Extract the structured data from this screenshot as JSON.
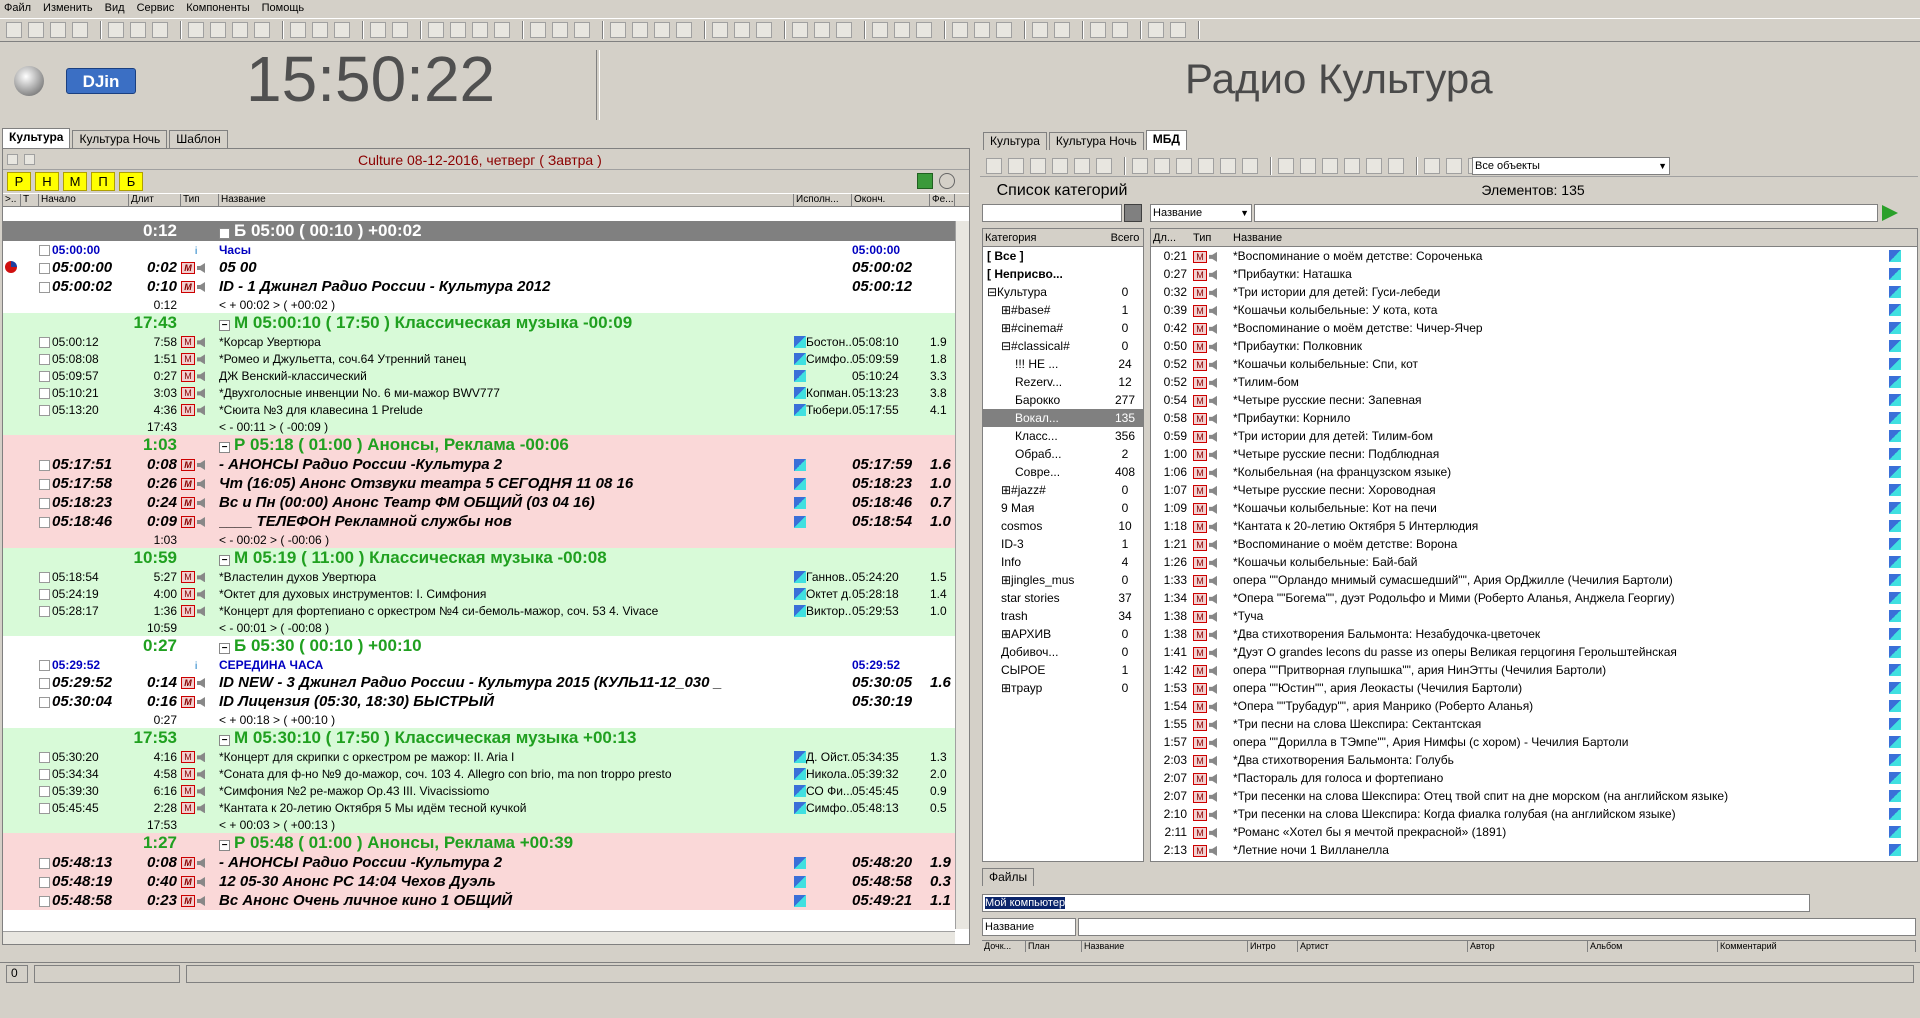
{
  "menu": [
    "Файл",
    "Изменить",
    "Вид",
    "Сервис",
    "Компоненты",
    "Помощь"
  ],
  "logo": "DJin",
  "clock": "15:50:22",
  "station": "Радио Культура",
  "left_tabs": [
    "Культура",
    "Культура Ночь",
    "Шаблон"
  ],
  "playlist_title": "Culture 08-12-2016, четверг ( Завтра )",
  "yellow_buttons": [
    "Р",
    "Н",
    "М",
    "П",
    "Б"
  ],
  "columns": [
    ">..",
    "Т",
    "Начало",
    "Длит",
    "Тип",
    "Название",
    "Исполн...",
    "Оконч.",
    "Фе..."
  ],
  "rows": [
    {
      "k": "blk",
      "bg": "gray",
      "dur": "0:12",
      "name": "Б 05:00 ( 00:10 ) +00:02"
    },
    {
      "k": "it",
      "bg": "white",
      "start": "05:00:00",
      "name": "Часы",
      "end": "05:00:00",
      "blue": true
    },
    {
      "k": "big",
      "bg": "white",
      "start": "05:00:00",
      "dur": "0:02",
      "name": "05 00",
      "end": "05:00:02"
    },
    {
      "k": "big",
      "bg": "white",
      "start": "05:00:02",
      "dur": "0:10",
      "name": "ID - 1 Джингл Радио России - Культура 2012",
      "end": "05:00:12"
    },
    {
      "k": "it",
      "bg": "white",
      "dur": "0:12",
      "name": "< + 00:02 > ( +00:02 )"
    },
    {
      "k": "blk",
      "bg": "green",
      "dur": "17:43",
      "name": "М 05:00:10 ( 17:50 ) Классическая музыка -00:09"
    },
    {
      "k": "it",
      "bg": "green",
      "start": "05:00:12",
      "dur": "7:58",
      "name": "*Корсар Увертюра",
      "art": "Бостон...",
      "end": "05:08:10",
      "fe": "1.9"
    },
    {
      "k": "it",
      "bg": "green",
      "start": "05:08:08",
      "dur": "1:51",
      "name": "*Ромео и Джульетта, соч.64 Утренний танец",
      "art": "Симфо...",
      "end": "05:09:59",
      "fe": "1.8"
    },
    {
      "k": "it",
      "bg": "green",
      "start": "05:09:57",
      "dur": "0:27",
      "name": "ДЖ Венский-классический",
      "art": "",
      "end": "05:10:24",
      "fe": "3.3"
    },
    {
      "k": "it",
      "bg": "green",
      "start": "05:10:21",
      "dur": "3:03",
      "name": "*Двухголосные инвенции No. 6 ми-мажор BWV777",
      "art": "Копман...",
      "end": "05:13:23",
      "fe": "3.8"
    },
    {
      "k": "it",
      "bg": "green",
      "start": "05:13:20",
      "dur": "4:36",
      "name": "*Сюита №3 для клавесина 1 Prelude",
      "art": "Тюбери...",
      "end": "05:17:55",
      "fe": "4.1"
    },
    {
      "k": "it",
      "bg": "green",
      "dur": "17:43",
      "name": "< - 00:11 > ( -00:09 )"
    },
    {
      "k": "blk",
      "bg": "pink",
      "dur": "1:03",
      "name": "Р 05:18 ( 01:00 ) Анонсы, Реклама -00:06"
    },
    {
      "k": "big",
      "bg": "pink",
      "start": "05:17:51",
      "dur": "0:08",
      "name": "- АНОНСЫ Радио России -Культура 2",
      "end": "05:17:59",
      "fe": "1.6"
    },
    {
      "k": "big",
      "bg": "pink",
      "start": "05:17:58",
      "dur": "0:26",
      "name": "Чт (16:05) Анонс Отзвуки театра 5 СЕГОДНЯ 11 08 16",
      "end": "05:18:23",
      "fe": "1.0"
    },
    {
      "k": "big",
      "bg": "pink",
      "start": "05:18:23",
      "dur": "0:24",
      "name": "Вс и Пн (00:00) Анонс Театр ФМ ОБЩИЙ (03 04 16)",
      "end": "05:18:46",
      "fe": "0.7"
    },
    {
      "k": "big",
      "bg": "pink",
      "start": "05:18:46",
      "dur": "0:09",
      "name": "____ ТЕЛЕФОН Рекламной службы нов",
      "end": "05:18:54",
      "fe": "1.0"
    },
    {
      "k": "it",
      "bg": "pink",
      "dur": "1:03",
      "name": "< - 00:02 > ( -00:06 )"
    },
    {
      "k": "blk",
      "bg": "green",
      "dur": "10:59",
      "name": "М 05:19 ( 11:00 ) Классическая  музыка -00:08"
    },
    {
      "k": "it",
      "bg": "green",
      "start": "05:18:54",
      "dur": "5:27",
      "name": "*Властелин духов Увертюра",
      "art": "Ганнов...",
      "end": "05:24:20",
      "fe": "1.5"
    },
    {
      "k": "it",
      "bg": "green",
      "start": "05:24:19",
      "dur": "4:00",
      "name": "*Октет для духовых инструментов: I. Симфония",
      "art": "Октет д...",
      "end": "05:28:18",
      "fe": "1.4"
    },
    {
      "k": "it",
      "bg": "green",
      "start": "05:28:17",
      "dur": "1:36",
      "name": "*Концерт для фортепиано с оркестром №4 си-бемоль-мажор, соч. 53 4. Vivace",
      "art": "Виктор...",
      "end": "05:29:53",
      "fe": "1.0"
    },
    {
      "k": "it",
      "bg": "green",
      "dur": "10:59",
      "name": "< - 00:01 > ( -00:08 )"
    },
    {
      "k": "blk",
      "bg": "white",
      "dur": "0:27",
      "name": "Б 05:30 ( 00:10 ) +00:10"
    },
    {
      "k": "it",
      "bg": "white",
      "start": "05:29:52",
      "name": "СЕРЕДИНА ЧАСА",
      "end": "05:29:52",
      "blue": true
    },
    {
      "k": "big",
      "bg": "white",
      "start": "05:29:52",
      "dur": "0:14",
      "name": "ID NEW - 3 Джингл Радио России - Культура 2015 (КУЛЬ11-12_030 _",
      "end": "05:30:05",
      "fe": "1.6"
    },
    {
      "k": "big",
      "bg": "white",
      "start": "05:30:04",
      "dur": "0:16",
      "name": "ID Лицензия (05:30, 18:30) БЫСТРЫЙ",
      "end": "05:30:19"
    },
    {
      "k": "it",
      "bg": "white",
      "dur": "0:27",
      "name": "< + 00:18 > ( +00:10 )"
    },
    {
      "k": "blk",
      "bg": "green",
      "dur": "17:53",
      "name": "М 05:30:10 ( 17:50 ) Классическая музыка +00:13"
    },
    {
      "k": "it",
      "bg": "green",
      "start": "05:30:20",
      "dur": "4:16",
      "name": "*Концерт для скрипки с оркестром ре мажор: II. Aria I",
      "art": "Д. Ойст...",
      "end": "05:34:35",
      "fe": "1.3"
    },
    {
      "k": "it",
      "bg": "green",
      "start": "05:34:34",
      "dur": "4:58",
      "name": "*Соната для ф-но №9 до-мажор, соч. 103 4. Allegro con brio, ma non troppo presto",
      "art": "Никола...",
      "end": "05:39:32",
      "fe": "2.0"
    },
    {
      "k": "it",
      "bg": "green",
      "start": "05:39:30",
      "dur": "6:16",
      "name": "*Симфония №2 ре-мажор Op.43 III. Vivacissiomo",
      "art": "СО Фи...",
      "end": "05:45:45",
      "fe": "0.9"
    },
    {
      "k": "it",
      "bg": "green",
      "start": "05:45:45",
      "dur": "2:28",
      "name": "*Кантата к 20-летию Октября 5 Мы идём тесной кучкой",
      "art": "Симфо...",
      "end": "05:48:13",
      "fe": "0.5"
    },
    {
      "k": "it",
      "bg": "green",
      "dur": "17:53",
      "name": "< + 00:03 > ( +00:13 )"
    },
    {
      "k": "blk",
      "bg": "pink",
      "dur": "1:27",
      "name": "Р 05:48 ( 01:00 ) Анонсы, Реклама +00:39"
    },
    {
      "k": "big",
      "bg": "pink",
      "start": "05:48:13",
      "dur": "0:08",
      "name": "- АНОНСЫ Радио России -Культура 2",
      "end": "05:48:20",
      "fe": "1.9"
    },
    {
      "k": "big",
      "bg": "pink",
      "start": "05:48:19",
      "dur": "0:40",
      "name": "12 05-30 Анонс РС 14:04 Чехов Дуэль",
      "end": "05:48:58",
      "fe": "0.3"
    },
    {
      "k": "big",
      "bg": "pink",
      "start": "05:48:58",
      "dur": "0:23",
      "name": "Вс Анонс Очень личное кино 1 ОБЩИЙ",
      "end": "05:49:21",
      "fe": "1.1"
    }
  ],
  "right_tabs": [
    "Культура",
    "Культура Ночь",
    "МБД"
  ],
  "filter_select": "Все объекты",
  "cat_title": "Список категорий",
  "cat_headers": [
    "Категория",
    "Всего"
  ],
  "categories": [
    {
      "n": "[ Все ]",
      "c": "",
      "b": true,
      "i": 0
    },
    {
      "n": "[ Неприсво...",
      "c": "",
      "b": true,
      "i": 0
    },
    {
      "n": "⊟Культура",
      "c": "0",
      "i": 0
    },
    {
      "n": "⊞#base#",
      "c": "1",
      "i": 1
    },
    {
      "n": "⊞#cinema#",
      "c": "0",
      "i": 1
    },
    {
      "n": "⊟#classical#",
      "c": "0",
      "i": 1
    },
    {
      "n": "!!! НЕ ...",
      "c": "24",
      "i": 2
    },
    {
      "n": "Rezerv...",
      "c": "12",
      "i": 2
    },
    {
      "n": "Барокко",
      "c": "277",
      "i": 2
    },
    {
      "n": "Вокал...",
      "c": "135",
      "i": 2,
      "sel": true
    },
    {
      "n": "Класс...",
      "c": "356",
      "i": 2
    },
    {
      "n": "Обраб...",
      "c": "2",
      "i": 2
    },
    {
      "n": "Совре...",
      "c": "408",
      "i": 2
    },
    {
      "n": "⊞#jazz#",
      "c": "0",
      "i": 1
    },
    {
      "n": "9 Мая",
      "c": "0",
      "i": 1
    },
    {
      "n": "cosmos",
      "c": "10",
      "i": 1
    },
    {
      "n": "ID-3",
      "c": "1",
      "i": 1
    },
    {
      "n": "Info",
      "c": "4",
      "i": 1
    },
    {
      "n": "⊞jingles_mus",
      "c": "0",
      "i": 1
    },
    {
      "n": "star stories",
      "c": "37",
      "i": 1
    },
    {
      "n": "trash",
      "c": "34",
      "i": 1
    },
    {
      "n": "⊞АРХИВ",
      "c": "0",
      "i": 1
    },
    {
      "n": "Добивоч...",
      "c": "0",
      "i": 1
    },
    {
      "n": "СЫРОЕ",
      "c": "1",
      "i": 1
    },
    {
      "n": "⊞траур",
      "c": "0",
      "i": 1
    }
  ],
  "el_title": "Элементов: 135",
  "el_sort": "Название",
  "el_headers": [
    "Дл...",
    "Тип",
    "Название"
  ],
  "elements": [
    [
      "0:21",
      "*Воспоминание о моём детстве: Сороченька"
    ],
    [
      "0:27",
      "*Прибаутки: Наташка"
    ],
    [
      "0:32",
      "*Три истории для детей: Гуси-лебеди"
    ],
    [
      "0:39",
      "*Кошачьи колыбельные: У кота, кота"
    ],
    [
      "0:42",
      "*Воспоминание о моём детстве: Чичер-Ячер"
    ],
    [
      "0:50",
      "*Прибаутки: Полковник"
    ],
    [
      "0:52",
      "*Кошачьи колыбельные: Спи, кот"
    ],
    [
      "0:52",
      "*Тилим-бом"
    ],
    [
      "0:54",
      "*Четыре русские песни: Запевная"
    ],
    [
      "0:58",
      "*Прибаутки: Корнило"
    ],
    [
      "0:59",
      "*Три истории для детей: Тилим-бом"
    ],
    [
      "1:00",
      "*Четыре русские песни: Подблюдная"
    ],
    [
      "1:06",
      "*Колыбельная (на французском языке)"
    ],
    [
      "1:07",
      "*Четыре русские песни: Хороводная"
    ],
    [
      "1:09",
      "*Кошачьи колыбельные: Кот на печи"
    ],
    [
      "1:18",
      "*Кантата к 20-летию Октября 5 Интерлюдия"
    ],
    [
      "1:21",
      "*Воспоминание о моём детстве: Ворона"
    ],
    [
      "1:26",
      "*Кошачьи колыбельные: Бай-бай"
    ],
    [
      "1:33",
      "опера \"\"Орландо мнимый сумасшедший\"\", Ария ОрДжилле (Чечилия Бартоли)"
    ],
    [
      "1:34",
      "*Опера \"\"Богема\"\", дуэт Родольфо и Мими (Роберто Аланья, Анджела Георгиу)"
    ],
    [
      "1:38",
      "*Туча"
    ],
    [
      "1:38",
      "*Два стихотворения Бальмонта: Незабудочка-цветочек"
    ],
    [
      "1:41",
      "*Дуэт  O grandes lecons du passe из оперы Великая герцогиня Герольштейнская"
    ],
    [
      "1:42",
      "опера \"\"Притворная глупышка\"\", ария НинЭтты (Чечилия Бартоли)"
    ],
    [
      "1:53",
      "опера \"\"Юстин\"\", ария Леокасты (Чечилия Бартоли)"
    ],
    [
      "1:54",
      "*Опера \"\"Трубадур\"\", ария Манрико (Роберто Аланья)"
    ],
    [
      "1:55",
      "*Три песни на слова Шекспира: Сектантская"
    ],
    [
      "1:57",
      "опера \"\"Дорилла в ТЭмпе\"\", Ария Нимфы (с хором) - Чечилия Бартоли"
    ],
    [
      "2:03",
      "*Два стихотворения Бальмонта: Голубь"
    ],
    [
      "2:07",
      "*Пасторaль для голоса и фортепиано"
    ],
    [
      "2:07",
      "*Три песенки на слова Шекспира: Отец твой спит на дне морском (на английском языке)"
    ],
    [
      "2:10",
      "*Три песенки на слова Шекспира: Когда фиалка голубая (на английском языке)"
    ],
    [
      "2:11",
      "*Романс «Хотел бы я мечтой прекрасной» (1891)"
    ],
    [
      "2:13",
      "*Летние ночи 1 Вилланелла"
    ]
  ],
  "files_tab": "Файлы",
  "files_path": "Мой компьютер",
  "files_sort": "Название",
  "files_headers": [
    "Дочк...",
    "План",
    "Название",
    "Интро",
    "Артист",
    "Автор",
    "Альбом",
    "Комментарий"
  ],
  "status_num": "0"
}
